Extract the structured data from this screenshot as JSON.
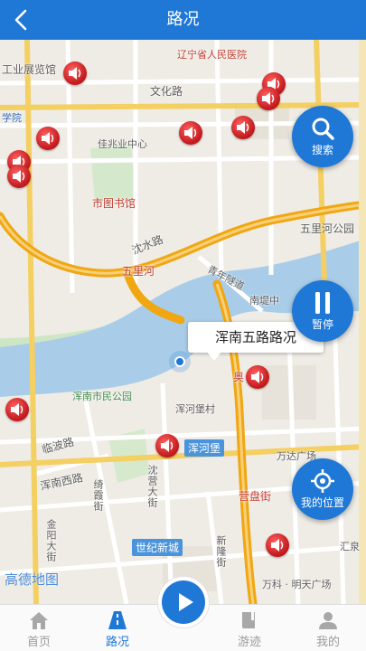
{
  "header": {
    "title": "路况",
    "back_icon": "chevron-left-icon"
  },
  "map": {
    "labels": {
      "liaoning_hospital": "辽宁省人民医院",
      "industry_hall": "工业展览馆",
      "wenhua_road": "文化路",
      "jiazhaoye": "佳兆业中心",
      "xuefu": "学院",
      "library": "市图书馆",
      "shenshui_road": "沈水路",
      "wulihe": "五里河",
      "wulihe_park": "五里河公园",
      "qingnian_tunnel": "青年隧道",
      "nanjing_center": "南堤中",
      "hunnan_park": "浑南市民公园",
      "aoti": "奥",
      "hunhebao_village": "浑河堡村",
      "hunhebao": "浑河堡",
      "wanda": "万达广场",
      "linbo_road": "临波路",
      "hunnan_west_road": "浑南西路",
      "yingpan_street": "营盘街",
      "qixia_street": "绮霞街",
      "shenjing_street": "沈营大街",
      "century_city": "世纪新城",
      "xinlong_street": "新隆街",
      "jinfeng_street": "金阳大街",
      "huiquan": "汇泉",
      "wanke": "万科 · 明天广场",
      "gaode": "高德地图"
    },
    "popup_text": "浑南五路路况",
    "speaker_icon": "speaker-icon",
    "location_icon": "current-location-icon"
  },
  "actions": {
    "search_label": "搜索",
    "pause_label": "暂停",
    "my_location_label": "我的位置"
  },
  "tabs": {
    "home": "首页",
    "traffic": "路况",
    "tour": "游迹",
    "mine": "我的"
  },
  "colors": {
    "accent": "#1f78d6",
    "speaker_red": "#d42626",
    "river": "#a9cde8",
    "expressway": "#f4b41a"
  }
}
